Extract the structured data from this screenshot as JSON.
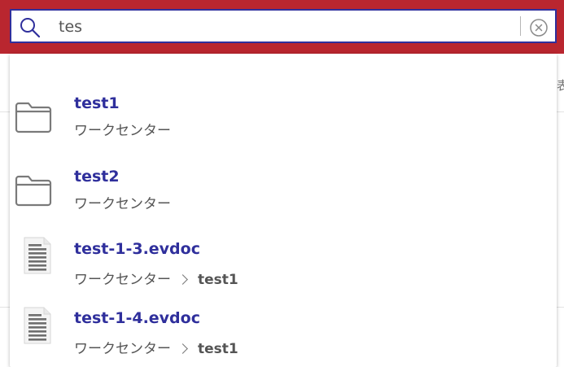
{
  "search": {
    "value": "tes",
    "placeholder": ""
  },
  "background": {
    "edge_glyph": "表"
  },
  "results": [
    {
      "type": "folder",
      "icon": "folder-icon",
      "title": "test1",
      "path": [
        "ワークセンター"
      ]
    },
    {
      "type": "folder",
      "icon": "folder-icon",
      "title": "test2",
      "path": [
        "ワークセンター"
      ]
    },
    {
      "type": "document",
      "icon": "document-icon",
      "title": "test-1-3.evdoc",
      "path": [
        "ワークセンター",
        "test1"
      ]
    },
    {
      "type": "document",
      "icon": "document-icon",
      "title": "test-1-4.evdoc",
      "path": [
        "ワークセンター",
        "test1"
      ]
    }
  ],
  "colors": {
    "topbar": "#b9262f",
    "accent": "#2f2f9c",
    "text_secondary": "#555555",
    "icon_gray": "#7a7a7a"
  }
}
